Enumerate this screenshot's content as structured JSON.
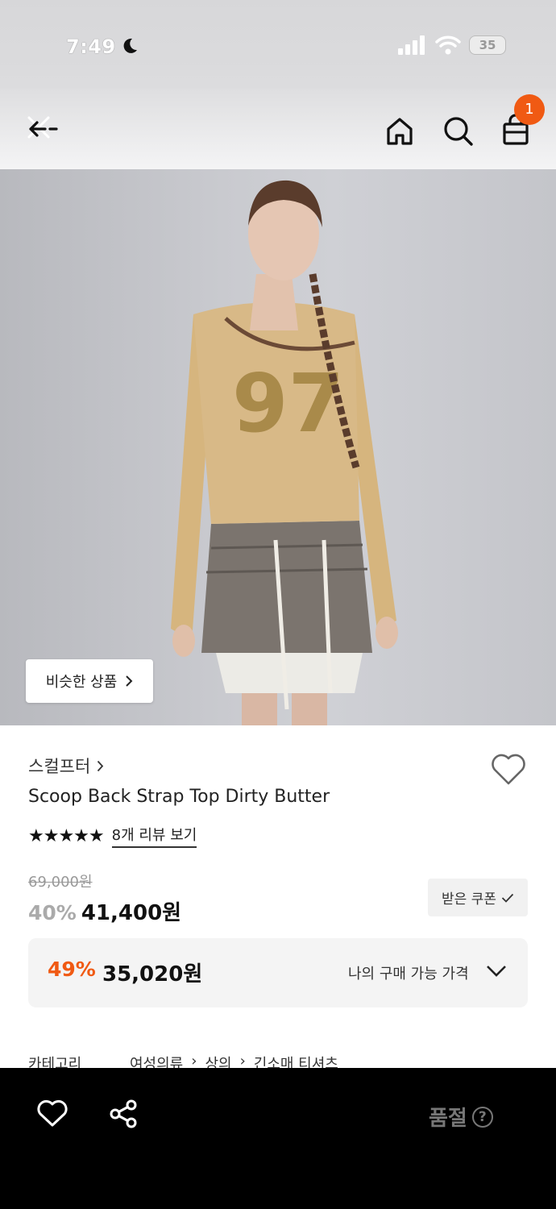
{
  "status_bar": {
    "time": "7:49",
    "battery": "35"
  },
  "header": {
    "cart_count": "1"
  },
  "hero": {
    "similar_label": "비슷한 상품",
    "graphic_number": "97"
  },
  "product": {
    "brand": "스컬프터",
    "title": "Scoop Back Strap Top Dirty Butter",
    "stars": "★★★★★",
    "review_link": "8개 리뷰 보기",
    "original_price": "69,000원",
    "discount_pct": "40%",
    "sale_price": "41,400원",
    "coupon_label": "받은 쿠폰"
  },
  "my_price": {
    "discount_pct": "49%",
    "price": "35,020원",
    "label": "나의 구매 가능 가격"
  },
  "category": {
    "label": "카테고리",
    "path": [
      "여성의류",
      "상의",
      "긴소매 티셔츠"
    ]
  },
  "bottom_bar": {
    "status_label": "품절",
    "help_symbol": "?"
  },
  "colors": {
    "accent": "#f05a13",
    "bottom_bar": "#000000"
  }
}
